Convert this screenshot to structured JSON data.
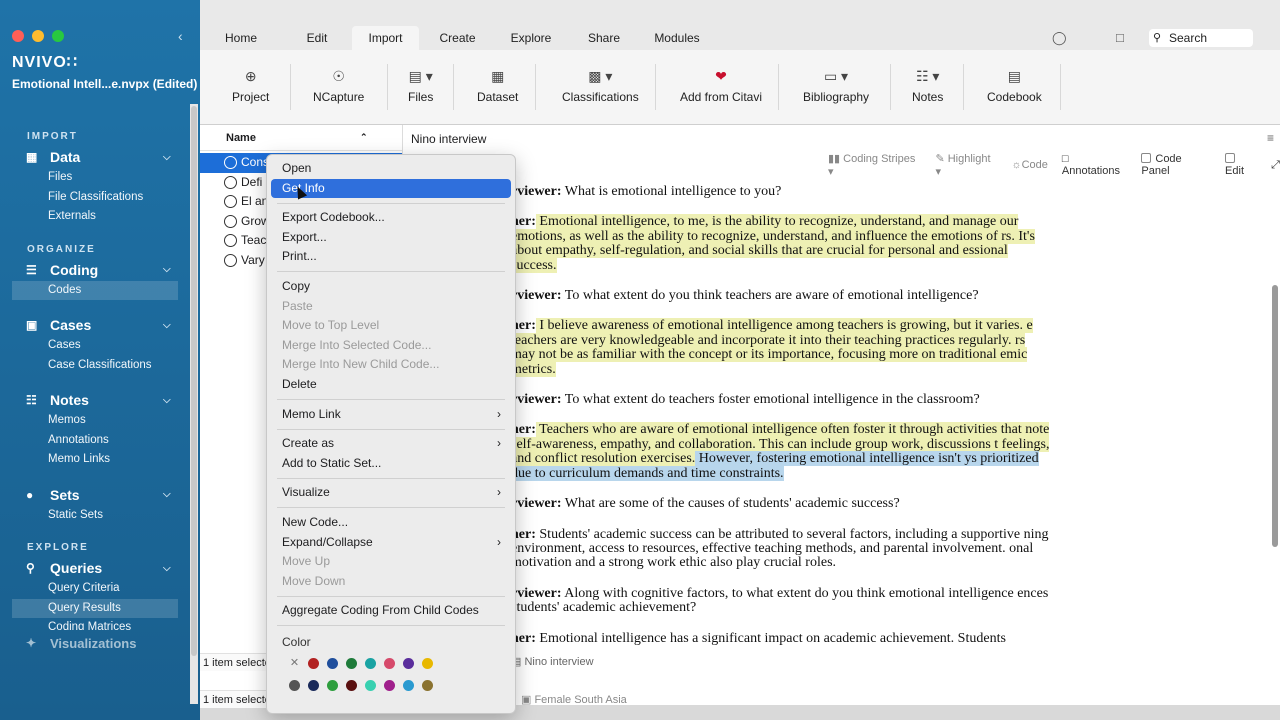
{
  "sidebar": {
    "brand": "NVIVO∷",
    "project": "Emotional Intell...e.nvpx (Edited)",
    "sections": {
      "import": "IMPORT",
      "organize": "ORGANIZE",
      "explore": "EXPLORE"
    },
    "groups": {
      "data": {
        "label": "Data",
        "items": [
          "Files",
          "File Classifications",
          "Externals"
        ]
      },
      "coding": {
        "label": "Coding",
        "items": [
          "Codes"
        ]
      },
      "cases": {
        "label": "Cases",
        "items": [
          "Cases",
          "Case Classifications"
        ]
      },
      "notes": {
        "label": "Notes",
        "items": [
          "Memos",
          "Annotations",
          "Memo Links"
        ]
      },
      "sets": {
        "label": "Sets",
        "items": [
          "Static Sets"
        ]
      },
      "queries": {
        "label": "Queries",
        "items": [
          "Query Criteria",
          "Query Results",
          "Coding Matrices"
        ]
      }
    },
    "hidden_item": "Visualizations"
  },
  "toolbar": {
    "tabs": [
      "Home",
      "Edit",
      "Import",
      "Create",
      "Explore",
      "Share",
      "Modules"
    ],
    "active_tab": "Import",
    "search_placeholder": "Search",
    "ribbon": [
      "Project",
      "NCapture",
      "Files",
      "Dataset",
      "Classifications",
      "Add from Citavi",
      "Bibliography",
      "Notes",
      "Codebook"
    ]
  },
  "list": {
    "header": "Name",
    "rows": [
      "Cons",
      "Defi",
      "El an",
      "Grow",
      "Teac",
      "Vary"
    ],
    "status": "1 item selecte",
    "status2": "1 item selecte"
  },
  "document": {
    "title": "Nino interview",
    "tools": {
      "coding_stripes": "Coding Stripes",
      "highlight": "Highlight",
      "code": "Code",
      "annotations": "Annotations",
      "code_panel": "Code Panel",
      "edit": "Edit"
    },
    "paragraphs": [
      {
        "speaker": "rviewer:",
        "text": " What is emotional intelligence to you?"
      },
      {
        "speaker": "her:",
        "hl": " Emotional intelligence, to me, is the ability to recognize, understand, and manage our emotions, as well as the ability to recognize, understand, and influence the emotions of rs. It's about empathy, self-regulation, and social skills that are crucial for personal and essional success."
      },
      {
        "speaker": "rviewer:",
        "text": " To what extent do you think teachers are aware of emotional intelligence?"
      },
      {
        "speaker": "her:",
        "hl": " I believe awareness of emotional intelligence among teachers is growing, but it varies. e teachers are very knowledgeable and incorporate it into their teaching practices regularly. rs may not be as familiar with the concept or its importance, focusing more on traditional emic metrics."
      },
      {
        "speaker": "rviewer:",
        "text": " To what extent do teachers foster emotional intelligence in the classroom?"
      },
      {
        "speaker": "her:",
        "hl": " Teachers who are aware of emotional intelligence often foster it through activities that note self-awareness, empathy, and collaboration. This can include group work, discussions t feelings, and conflict resolution exercises.",
        "hl2": " However, fostering emotional intelligence isn't ys prioritized due to curriculum demands and time constraints."
      },
      {
        "speaker": "rviewer:",
        "text": " What are some of the causes of students' academic success?"
      },
      {
        "speaker": "her:",
        "text": " Students' academic success can be attributed to several factors, including a supportive ning environment, access to resources, effective teaching methods, and parental involvement. onal motivation and a strong work ethic also play crucial roles."
      },
      {
        "speaker": "rviewer:",
        "text": " Along with cognitive factors, to what extent do you think emotional intelligence ences students' academic achievement?"
      },
      {
        "speaker": "her:",
        "text": " Emotional intelligence has a significant impact on academic achievement. Students"
      }
    ],
    "footer": "Nino interview",
    "footer2": "Female South Asia"
  },
  "context_menu": {
    "items": [
      {
        "label": "Open"
      },
      {
        "label": "Get Info",
        "highlighted": true
      },
      {
        "sep": true
      },
      {
        "label": "Export Codebook..."
      },
      {
        "label": "Export..."
      },
      {
        "label": "Print..."
      },
      {
        "sep": true
      },
      {
        "label": "Copy"
      },
      {
        "label": "Paste",
        "disabled": true
      },
      {
        "label": "Move to Top Level",
        "disabled": true
      },
      {
        "label": "Merge Into Selected Code...",
        "disabled": true
      },
      {
        "label": "Merge Into New Child Code...",
        "disabled": true
      },
      {
        "label": "Delete"
      },
      {
        "sep": true
      },
      {
        "label": "Memo Link",
        "submenu": true
      },
      {
        "sep": true
      },
      {
        "label": "Create as",
        "submenu": true
      },
      {
        "label": "Add to Static Set..."
      },
      {
        "sep": true
      },
      {
        "label": "Visualize",
        "submenu": true
      },
      {
        "sep": true
      },
      {
        "label": "New Code..."
      },
      {
        "label": "Expand/Collapse",
        "submenu": true
      },
      {
        "label": "Move Up",
        "disabled": true
      },
      {
        "label": "Move Down",
        "disabled": true
      },
      {
        "sep": true
      },
      {
        "label": "Aggregate Coding From Child Codes"
      },
      {
        "sep": true
      }
    ],
    "color_heading": "Color",
    "colors_row1": [
      "#b22222",
      "#1f4e9c",
      "#1e7b3a",
      "#1aa3a3",
      "#d64a6b",
      "#5a2d9c",
      "#e8b800"
    ],
    "colors_row2": [
      "#555555",
      "#1a2a5a",
      "#2e9e3e",
      "#5a1010",
      "#38d0b0",
      "#a0208c",
      "#2a9ad0",
      "#8a7230"
    ]
  }
}
